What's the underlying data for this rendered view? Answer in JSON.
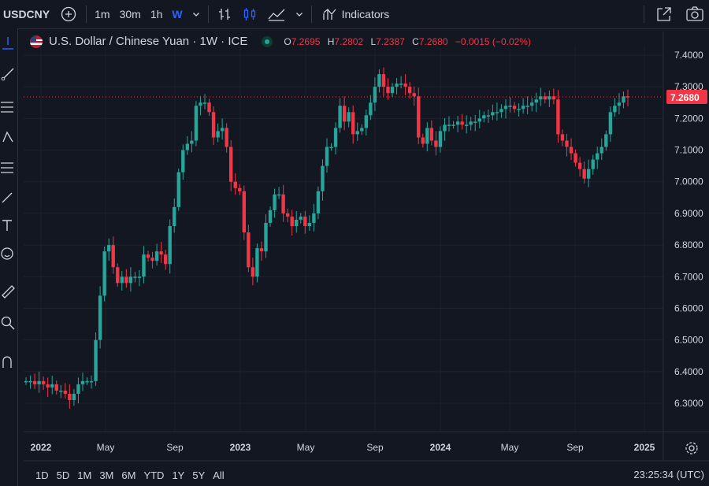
{
  "toolbar": {
    "symbol": "USDCNY",
    "intervals": [
      "1m",
      "30m",
      "1h",
      "W"
    ],
    "active_interval": "W",
    "indicators_label": "Indicators"
  },
  "legend": {
    "title": "U.S. Dollar / Chinese Yuan · 1W · ICE",
    "o_label": "O",
    "o_value": "7.2695",
    "h_label": "H",
    "h_value": "7.2802",
    "l_label": "L",
    "l_value": "7.2387",
    "c_label": "C",
    "c_value": "7.2680",
    "change": "−0.0015 (−0.02%)"
  },
  "ranges": [
    "1D",
    "5D",
    "1M",
    "3M",
    "6M",
    "YTD",
    "1Y",
    "5Y",
    "All"
  ],
  "clock": "23:25:34 (UTC)",
  "colors": {
    "up": "#26a69a",
    "down": "#f23645",
    "background": "#131722",
    "grid": "#1e222d",
    "accent": "#2962ff"
  },
  "chart_data": {
    "type": "candlestick",
    "title": "U.S. Dollar / Chinese Yuan · 1W · ICE",
    "ylim": [
      6.25,
      7.45
    ],
    "y_ticks": [
      "7.4000",
      "7.3000",
      "7.2000",
      "7.1000",
      "7.0000",
      "6.9000",
      "6.8000",
      "6.7000",
      "6.6000",
      "6.5000",
      "6.4000",
      "6.3000"
    ],
    "x_ticks": [
      "2022",
      "May",
      "Sep",
      "2023",
      "May",
      "Sep",
      "2024",
      "May",
      "Sep",
      "2025"
    ],
    "last_price": "7.2680",
    "closes": [
      6.37,
      6.37,
      6.36,
      6.37,
      6.36,
      6.35,
      6.36,
      6.34,
      6.34,
      6.33,
      6.31,
      6.33,
      6.36,
      6.37,
      6.37,
      6.37,
      6.5,
      6.64,
      6.78,
      6.8,
      6.73,
      6.68,
      6.7,
      6.68,
      6.7,
      6.7,
      6.7,
      6.77,
      6.76,
      6.75,
      6.78,
      6.77,
      6.74,
      6.86,
      6.92,
      7.03,
      7.1,
      7.12,
      7.13,
      7.24,
      7.25,
      7.25,
      7.22,
      7.14,
      7.16,
      7.17,
      7.11,
      7.0,
      6.98,
      6.97,
      6.84,
      6.73,
      6.7,
      6.79,
      6.78,
      6.87,
      6.91,
      6.96,
      6.96,
      6.9,
      6.89,
      6.86,
      6.88,
      6.89,
      6.86,
      6.87,
      6.9,
      6.97,
      7.05,
      7.11,
      7.11,
      7.17,
      7.24,
      7.19,
      7.22,
      7.15,
      7.16,
      7.17,
      7.21,
      7.25,
      7.3,
      7.34,
      7.3,
      7.28,
      7.3,
      7.31,
      7.31,
      7.3,
      7.28,
      7.27,
      7.14,
      7.12,
      7.17,
      7.13,
      7.11,
      7.16,
      7.18,
      7.18,
      7.18,
      7.19,
      7.18,
      7.18,
      7.19,
      7.19,
      7.2,
      7.21,
      7.21,
      7.22,
      7.22,
      7.23,
      7.24,
      7.24,
      7.23,
      7.23,
      7.24,
      7.24,
      7.25,
      7.26,
      7.27,
      7.26,
      7.27,
      7.26,
      7.15,
      7.13,
      7.11,
      7.09,
      7.06,
      7.04,
      7.01,
      7.04,
      7.07,
      7.09,
      7.11,
      7.15,
      7.22,
      7.24,
      7.25,
      7.27,
      7.268
    ]
  }
}
